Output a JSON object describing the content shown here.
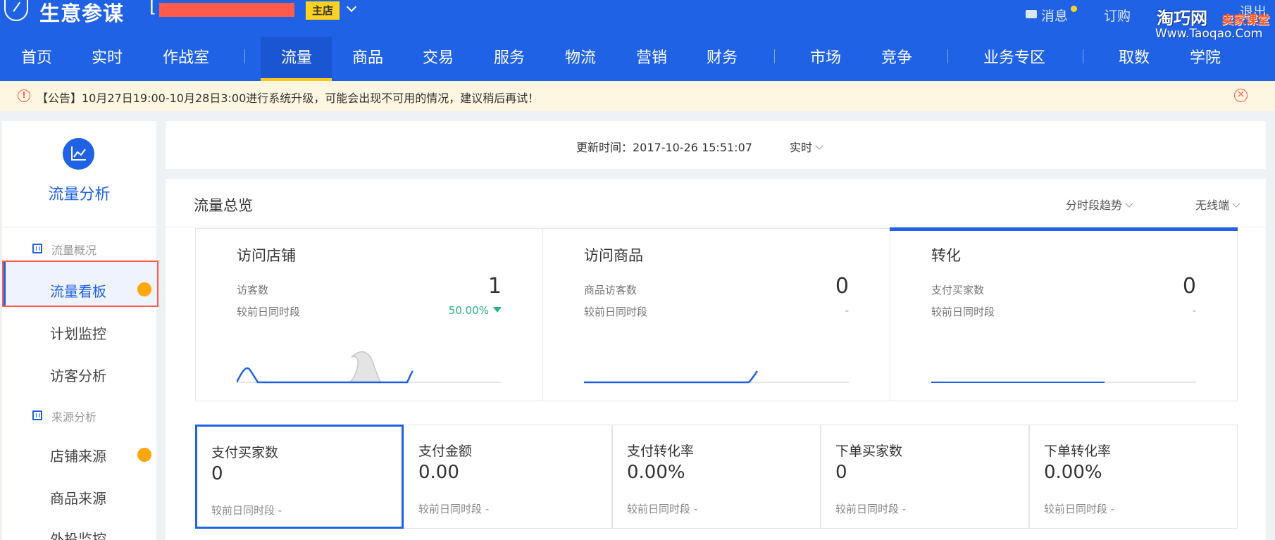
{
  "header": {
    "app_title": "生意参谋",
    "shop_bracket": "[",
    "shop_badge": "主店",
    "messages_label": "消息",
    "orders_label": "订购",
    "logout_label": "退出",
    "watermark_site": "淘巧网",
    "watermark_tag": "卖家课堂",
    "watermark_url": "Www.Taoqao.Com"
  },
  "nav": {
    "items": [
      "首页",
      "实时",
      "作战室",
      "流量",
      "商品",
      "交易",
      "服务",
      "物流",
      "营销",
      "财务",
      "市场",
      "竞争",
      "业务专区",
      "取数",
      "学院"
    ],
    "active": "流量"
  },
  "notice": {
    "icon": "alert-circle-icon",
    "text": "【公告】10月27日19:00-10月28日3:00进行系统升级，可能会出现不可用的情况，建议稍后再试！"
  },
  "sidebar": {
    "title": "流量分析",
    "groups": [
      {
        "label": "流量概况",
        "items": [
          "流量看板",
          "计划监控",
          "访客分析"
        ]
      },
      {
        "label": "来源分析",
        "items": [
          "店铺来源",
          "商品来源",
          "外投监控"
        ]
      }
    ],
    "active_item": "流量看板"
  },
  "update_bar": {
    "text": "更新时间：2017-10-26 15:51:07",
    "mode": "实时"
  },
  "overview": {
    "title": "流量总览",
    "trend_select": "分时段趋势",
    "device_select": "无线端",
    "cards": [
      {
        "title": "访问店铺",
        "label": "访客数",
        "value": "1",
        "compare_label": "较前日同时段",
        "compare_value": "50.00%",
        "trend": "down"
      },
      {
        "title": "访问商品",
        "label": "商品访客数",
        "value": "0",
        "compare_label": "较前日同时段",
        "compare_value": "-"
      },
      {
        "title": "转化",
        "label": "支付买家数",
        "value": "0",
        "compare_label": "较前日同时段",
        "compare_value": "-"
      }
    ],
    "metrics": [
      {
        "title": "支付买家数",
        "value": "0",
        "compare": "较前日同时段  -"
      },
      {
        "title": "支付金额",
        "value": "0.00",
        "compare": "较前日同时段  -"
      },
      {
        "title": "支付转化率",
        "value": "0.00%",
        "compare": "较前日同时段  -"
      },
      {
        "title": "下单买家数",
        "value": "0",
        "compare": "较前日同时段  -"
      },
      {
        "title": "下单转化率",
        "value": "0.00%",
        "compare": "较前日同时段  -"
      }
    ]
  },
  "colors": {
    "primary": "#2062e6",
    "accent": "#ffc61a",
    "alert": "#ff5a4a",
    "positive": "#22b28b",
    "dot": "#ffa70f"
  }
}
